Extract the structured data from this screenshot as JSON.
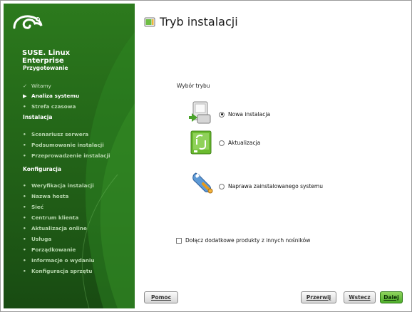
{
  "brand": {
    "name_line1": "SUSE. Linux",
    "name_line2": "Enterprise"
  },
  "window": {
    "title": "Tryb instalacji"
  },
  "sidebar": {
    "sections": [
      {
        "label": "Przygotowanie"
      },
      {
        "label": "Instalacja"
      },
      {
        "label": "Konfiguracja"
      }
    ],
    "items": [
      {
        "label": "Witamy",
        "state": "done"
      },
      {
        "label": "Analiza systemu",
        "state": "current"
      },
      {
        "label": "Strefa czasowa",
        "state": "pending"
      },
      {
        "label": "Scenariusz serwera",
        "state": "pending"
      },
      {
        "label": "Podsumowanie instalacji",
        "state": "pending"
      },
      {
        "label": "Przeprowadzenie instalacji",
        "state": "pending"
      },
      {
        "label": "Weryfikacja instalacji",
        "state": "pending"
      },
      {
        "label": "Nazwa hosta",
        "state": "pending"
      },
      {
        "label": "Sieć",
        "state": "pending"
      },
      {
        "label": "Centrum klienta",
        "state": "pending"
      },
      {
        "label": "Aktualizacja online",
        "state": "pending"
      },
      {
        "label": "Usługa",
        "state": "pending"
      },
      {
        "label": "Porządkowanie",
        "state": "pending"
      },
      {
        "label": "Informacje o wydaniu",
        "state": "pending"
      },
      {
        "label": "Konfiguracja sprzętu",
        "state": "pending"
      }
    ]
  },
  "main": {
    "mode_label": "Wybór trybu",
    "options": [
      {
        "label": "Nowa instalacja",
        "selected": true,
        "icon": "new-install-icon"
      },
      {
        "label": "Aktualizacja",
        "selected": false,
        "icon": "update-icon"
      },
      {
        "label": "Naprawa zainstalowanego systemu",
        "selected": false,
        "icon": "repair-icon"
      }
    ],
    "addon_checkbox": {
      "label": "Dołącz dodatkowe produkty z innych nośników",
      "checked": false
    }
  },
  "buttons": {
    "help": "Pomoc",
    "abort": "Przerwij",
    "back": "Wstecz",
    "next": "Dalej"
  },
  "colors": {
    "sidebar_green": "#256a19",
    "accent_green": "#4fae2b"
  }
}
